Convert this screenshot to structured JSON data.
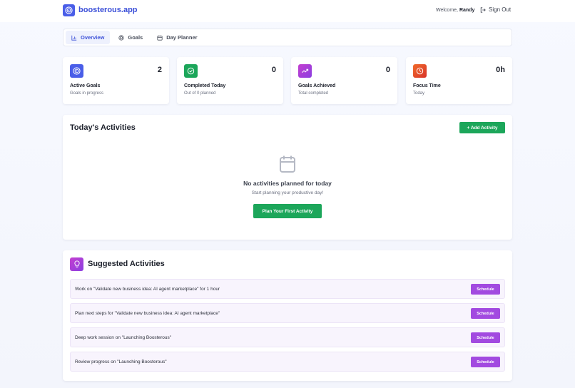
{
  "header": {
    "app_name": "boosterous.app",
    "welcome_prefix": "Welcome,",
    "user_name": "Randy",
    "signout_label": "Sign Out"
  },
  "tabs": [
    {
      "label": "Overview",
      "icon": "bar-chart-icon",
      "active": true
    },
    {
      "label": "Goals",
      "icon": "target-icon",
      "active": false
    },
    {
      "label": "Day Planner",
      "icon": "calendar-icon",
      "active": false
    }
  ],
  "stats": [
    {
      "title": "Active Goals",
      "subtitle": "Goals in progress",
      "value": "2",
      "icon": "target-icon",
      "color": "#4a5ee8"
    },
    {
      "title": "Completed Today",
      "subtitle": "Out of 0 planned",
      "value": "0",
      "icon": "check-circle-icon",
      "color": "#1ca65a"
    },
    {
      "title": "Goals Achieved",
      "subtitle": "Total completed",
      "value": "0",
      "icon": "trending-up-icon",
      "color": "#b23fd8"
    },
    {
      "title": "Focus Time",
      "subtitle": "Today",
      "value": "0h",
      "icon": "clock-icon",
      "color": "#e8502a"
    }
  ],
  "activities": {
    "title": "Today's Activities",
    "add_label": "+ Add Activity",
    "empty_title": "No activities planned for today",
    "empty_subtitle": "Start planning your productive day!",
    "plan_label": "Plan Your First Activity"
  },
  "suggested": {
    "title": "Suggested Activities",
    "schedule_label": "Schedule",
    "items": [
      "Work on \"Validate new business idea: AI agent marketplace\" for 1 hour",
      "Plan next steps for \"Validate new business idea: AI agent marketplace\"",
      "Deep work session on \"Launching Boosterous\"",
      "Review progress on \"Launching Boosterous\""
    ]
  },
  "colors": {
    "brand": "#3b4fd8",
    "green": "#1ca65a",
    "purple": "#a24ae0"
  }
}
